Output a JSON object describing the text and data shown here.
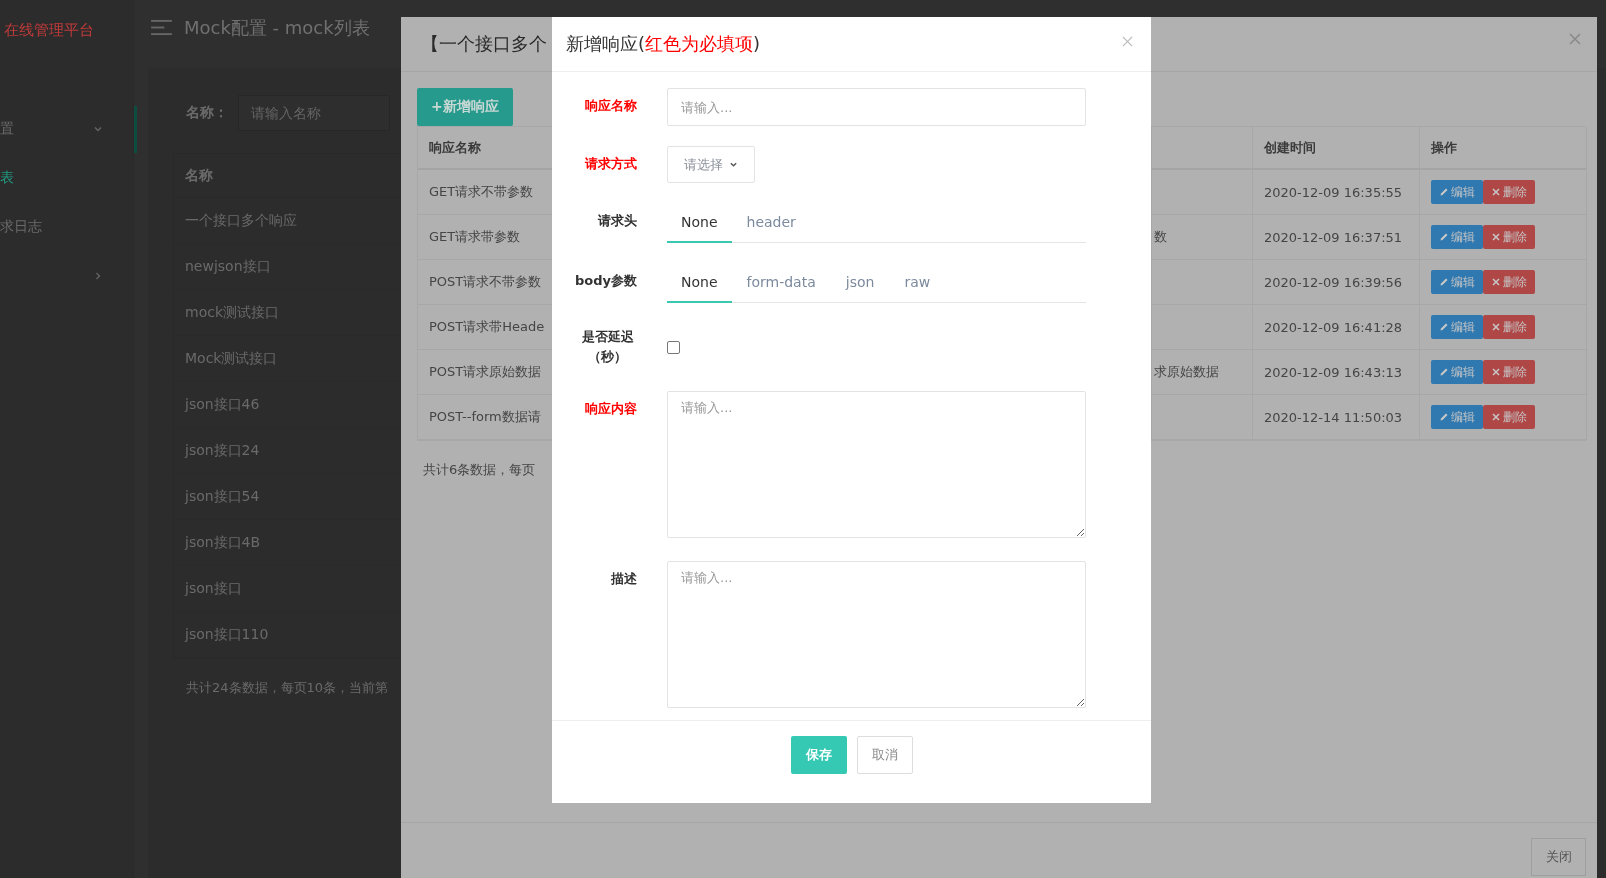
{
  "sidebar": {
    "brand": "在线管理平台",
    "items": [
      {
        "label": "置",
        "kind": "group",
        "expanded": true,
        "selected": false
      },
      {
        "label": "表",
        "kind": "link",
        "selected": true
      },
      {
        "label": "求日志",
        "kind": "link",
        "selected": false
      },
      {
        "kind": "group",
        "expanded": false,
        "selected": false
      }
    ]
  },
  "header": {
    "title": "Mock配置 - mock列表"
  },
  "search": {
    "label": "名称：",
    "placeholder": "请输入名称"
  },
  "list": {
    "columns": [
      "名称"
    ],
    "rows": [
      "一个接口多个响应",
      "newjson接口",
      "mock测试接口",
      "Mock测试接口",
      "json接口46",
      "json接口24",
      "json接口54",
      "json接口4B",
      "json接口",
      "json接口110"
    ],
    "footer": "共计24条数据，每页10条，当前第"
  },
  "responses_dialog": {
    "title": "【一个接口多个",
    "add_button": "+新增响应",
    "columns": [
      "响应名称",
      "创建时间",
      "操作"
    ],
    "rows": [
      {
        "name": "GET请求不带参数",
        "created": "2020-12-09 16:35:55",
        "actions": [
          "编辑",
          "删除"
        ]
      },
      {
        "name": "GET请求带参数",
        "column_3": "数",
        "created": "2020-12-09 16:37:51",
        "actions": [
          "编辑",
          "删除"
        ]
      },
      {
        "name": "POST请求不带参数",
        "created": "2020-12-09 16:39:56",
        "actions": [
          "编辑",
          "删除"
        ]
      },
      {
        "name": "POST请求带Heade",
        "created": "2020-12-09 16:41:28",
        "actions": [
          "编辑",
          "删除"
        ]
      },
      {
        "name": "POST请求原始数据",
        "column_3": "求原始数据",
        "created": "2020-12-09 16:43:13",
        "actions": [
          "编辑",
          "删除"
        ]
      },
      {
        "name": "POST--form数据请",
        "created": "2020-12-14 11:50:03",
        "actions": [
          "编辑",
          "删除"
        ]
      }
    ],
    "footer": "共计6条数据，每页",
    "close_button": "关闭"
  },
  "new_response_dialog": {
    "title": [
      {
        "text": "新增响应(",
        "kind": "plain"
      },
      {
        "text": "红色为必填项",
        "kind": "required"
      },
      {
        "text": ")",
        "kind": "plain"
      }
    ],
    "fields": [
      {
        "label": "响应名称",
        "required": true,
        "kind": "input",
        "placeholder": "请输入..."
      },
      {
        "label": "请求方式",
        "required": true,
        "kind": "select",
        "placeholder": "请选择"
      },
      {
        "label": "请求头",
        "required": false,
        "kind": "tabs",
        "tabs": [
          {
            "label": "None",
            "selected": true
          },
          {
            "label": "header",
            "selected": false
          }
        ]
      },
      {
        "label": "body参数",
        "required": false,
        "kind": "tabs",
        "tabs": [
          {
            "label": "None",
            "selected": true
          },
          {
            "label": "form-data",
            "selected": false
          },
          {
            "label": "json",
            "selected": false
          },
          {
            "label": "raw",
            "selected": false
          }
        ]
      },
      {
        "label": "是否延迟（秒）",
        "required": false,
        "kind": "checkbox",
        "checked": false
      },
      {
        "label": "响应内容",
        "required": true,
        "kind": "textarea",
        "placeholder": "请输入..."
      },
      {
        "label": "描述",
        "required": false,
        "kind": "textarea",
        "placeholder": "请输入..."
      }
    ],
    "save_button": "保存",
    "cancel_button": "取消"
  }
}
